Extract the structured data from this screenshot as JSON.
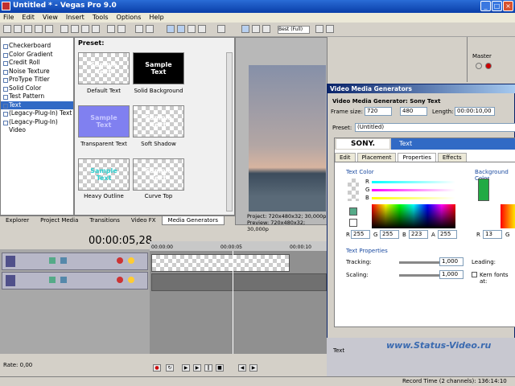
{
  "window": {
    "title": "Untitled * - Vegas Pro 9.0"
  },
  "menu": [
    "File",
    "Edit",
    "View",
    "Insert",
    "Tools",
    "Options",
    "Help"
  ],
  "tree": [
    "Checkerboard",
    "Color Gradient",
    "Credit Roll",
    "Noise Texture",
    "ProType Titler",
    "Solid Color",
    "Test Pattern",
    "Text",
    "(Legacy-Plug-In) Text",
    "(Legacy-Plug-In) Video"
  ],
  "preset": {
    "label": "Preset:",
    "items": [
      {
        "thumb": "Sample\nText",
        "label": "Default Text"
      },
      {
        "thumb": "Sample\nText",
        "label": "Solid Background"
      },
      {
        "thumb": "Sample\nText",
        "label": "Transparent Text"
      },
      {
        "thumb": "Sample\nText",
        "label": "Soft Shadow"
      },
      {
        "thumb": "Sample\nText",
        "label": "Heavy Outline"
      },
      {
        "thumb": "Sample\nText",
        "label": "Curve Top"
      }
    ]
  },
  "tabs": [
    "Explorer",
    "Project Media",
    "Transitions",
    "Video FX",
    "Media Generators"
  ],
  "preview": {
    "quality": "Best (Full)",
    "project": "Project:   720x480x32; 30,000p",
    "preview": "Preview:   720x480x32; 30,000p"
  },
  "mixer": {
    "label": "Master"
  },
  "timecode": "00:00:05,28",
  "ruler": [
    "00:00:00",
    "00:00:05",
    "00:00:10"
  ],
  "rate": "Rate: 0,00",
  "dialog": {
    "title": "Video Media Generators",
    "generator": "Video Media Generator: Sony Text",
    "frame_size_label": "Frame size:",
    "width": "720",
    "height": "480",
    "length_label": "Length:",
    "length": "00:00:10,00",
    "preset_label": "Preset:",
    "preset_value": "(Untitled)",
    "sony": "SONY.",
    "plugin": "Text",
    "tabs": [
      "Edit",
      "Placement",
      "Properties",
      "Effects"
    ],
    "text_color_label": "Text Color",
    "bg_color_label": "Background Color",
    "r_label": "R",
    "g_label": "G",
    "b_label": "B",
    "a_label": "A",
    "r": "255",
    "g": "255",
    "b": "223",
    "a": "255",
    "bg_r": "13",
    "bg_g": "G",
    "props_label": "Text Properties",
    "tracking_label": "Tracking:",
    "tracking": "1,000",
    "leading_label": "Leading:",
    "scaling_label": "Scaling:",
    "scaling": "1,000",
    "kern_label": "Kern fonts at:"
  },
  "bottom": {
    "track": "Text"
  },
  "status": {
    "record_time": "Record Time (2 channels): 136:14:10"
  },
  "watermark": "www.Status-Video.ru",
  "colors": {
    "accent": "#316ac5",
    "title": "#0a3ea8"
  }
}
